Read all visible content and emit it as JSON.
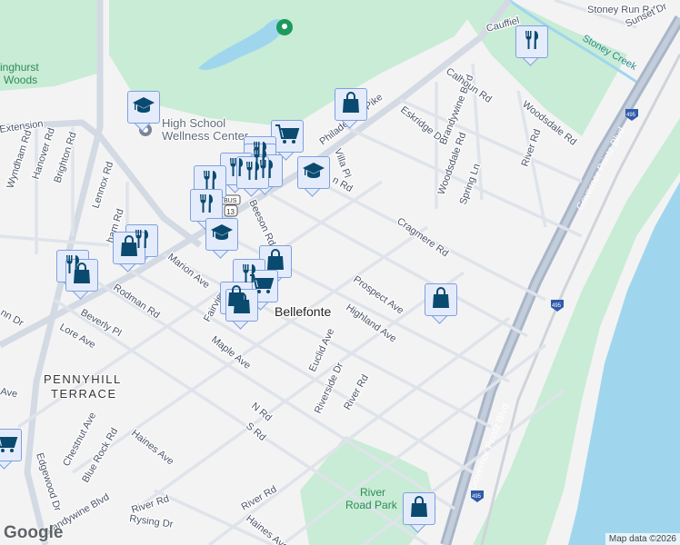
{
  "map": {
    "place": "Bellefonte",
    "neighborhood": [
      "PENNYHILL",
      "TERRACE"
    ],
    "poi": [
      "High School",
      "Wellness Center"
    ],
    "park": [
      "River",
      "Road Park"
    ],
    "area_top_left": [
      "inghurst",
      "Woods"
    ],
    "water_label": "Stoney Creek",
    "highway_shield": "495",
    "route_shield": "13",
    "bus_label": "BUS",
    "streets": {
      "philadelphia_pike": "Philadelphia Pike",
      "extension": "Extension",
      "wyndham": "Wyndham Rd",
      "hanover": "Hanover Rd",
      "brighton": "Brighton Rd",
      "lennox": "Lennox Rd",
      "marion": "Marion Ave",
      "rodman": "Rodman Rd",
      "beverly": "Beverly Pl",
      "lore": "Lore Ave",
      "maple": "Maple Ave",
      "fairview": "Fairview",
      "beeson": "Beeson Rd",
      "villa": "Villa Pl",
      "eskridge": "Eskridge Dr",
      "brandywine_blvd_n": "Brandywine Blvd",
      "calhoun": "Calhoun Rd",
      "woodsdale_rd": "Woodsdale Rd",
      "woodsdale": "Woodsdale Rd",
      "spring": "Spring Ln",
      "river_rd_n": "River Rd",
      "cragmere": "Cragmere Rd",
      "prospect": "Prospect Ave",
      "highland": "Highland Ave",
      "euclid": "Euclid Ave",
      "riverside": "Riverside Dr",
      "river_rd_mid": "River Rd",
      "n_rd": "N Rd",
      "s_rd": "S Rd",
      "haines": "Haines Ave",
      "haines_s": "Haines Ave",
      "chestnut": "Chestnut Ave",
      "blue_rock": "Blue Rock Rd",
      "edgewood": "Edgewood Dr",
      "brandywine_blvd_s": "Brandywine Blvd",
      "river_rd_sw": "River Rd",
      "river_rd_s": "River Rd",
      "rysing": "Rysing Dr",
      "governor_printz": "Governor Printz Blvd",
      "governor_printz_s": "Governor Printz Blvd",
      "stoney_run": "Stoney Run Rd",
      "sunset": "Sunset Dr",
      "cauffiel": "Cauffiel",
      "ave_left": "Ave",
      "nn_dr": "nn Dr",
      "rd_pike": "n Rd",
      "ham_rd": "ham Rd"
    },
    "attribution": "Map data ©2026",
    "logo": "Google"
  },
  "markers": [
    {
      "type": "restaurant",
      "icon": "fork-knife-icon"
    },
    {
      "type": "shopping",
      "icon": "shopping-bag-icon"
    },
    {
      "type": "school",
      "icon": "graduation-cap-icon"
    },
    {
      "type": "grocery",
      "icon": "shopping-cart-icon"
    }
  ],
  "colors": {
    "marker_icon": "#0b4a6f",
    "marker_bg": "#e4ecfb",
    "park": "#c8ecd5",
    "water": "#9fd6ee",
    "road": "#d6dce4",
    "highway": "#a9b6c8"
  }
}
